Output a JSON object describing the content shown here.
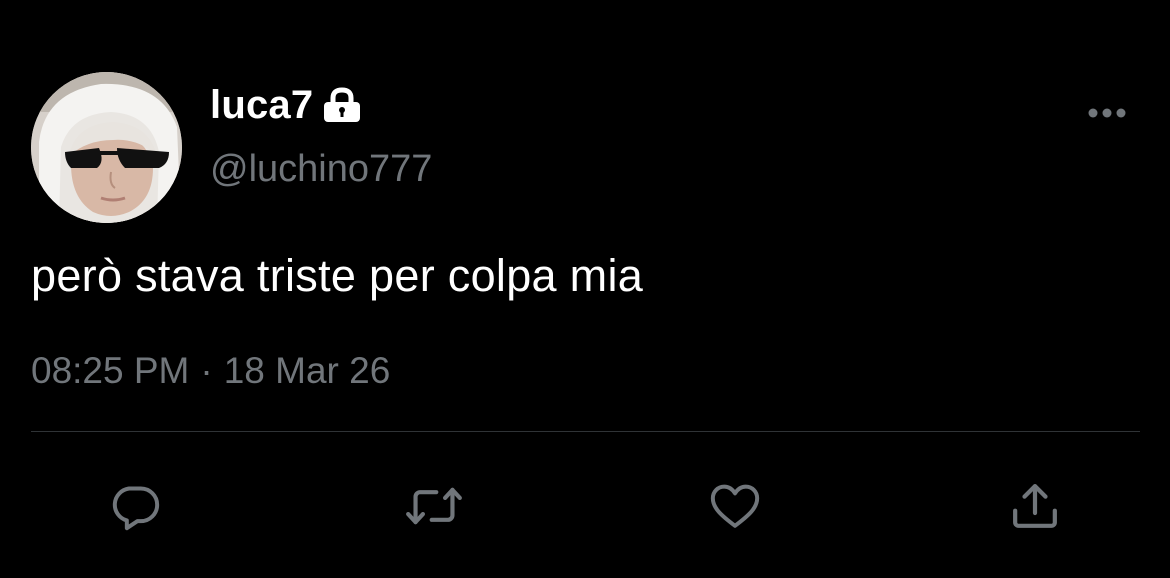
{
  "user": {
    "display_name": "luca7",
    "handle": "@luchino777",
    "protected": true
  },
  "tweet": {
    "text": "però stava triste per colpa mia",
    "time": "08:25 PM",
    "separator": "·",
    "date": "18 Mar 26"
  },
  "icons": {
    "lock": "lock-icon",
    "more": "more-icon",
    "reply": "reply-icon",
    "retweet": "retweet-icon",
    "like": "heart-icon",
    "share": "share-icon"
  },
  "colors": {
    "background": "#000000",
    "text_primary": "#ffffff",
    "text_secondary": "#71767b",
    "divider": "#2f3336",
    "icon": "#71767b"
  }
}
